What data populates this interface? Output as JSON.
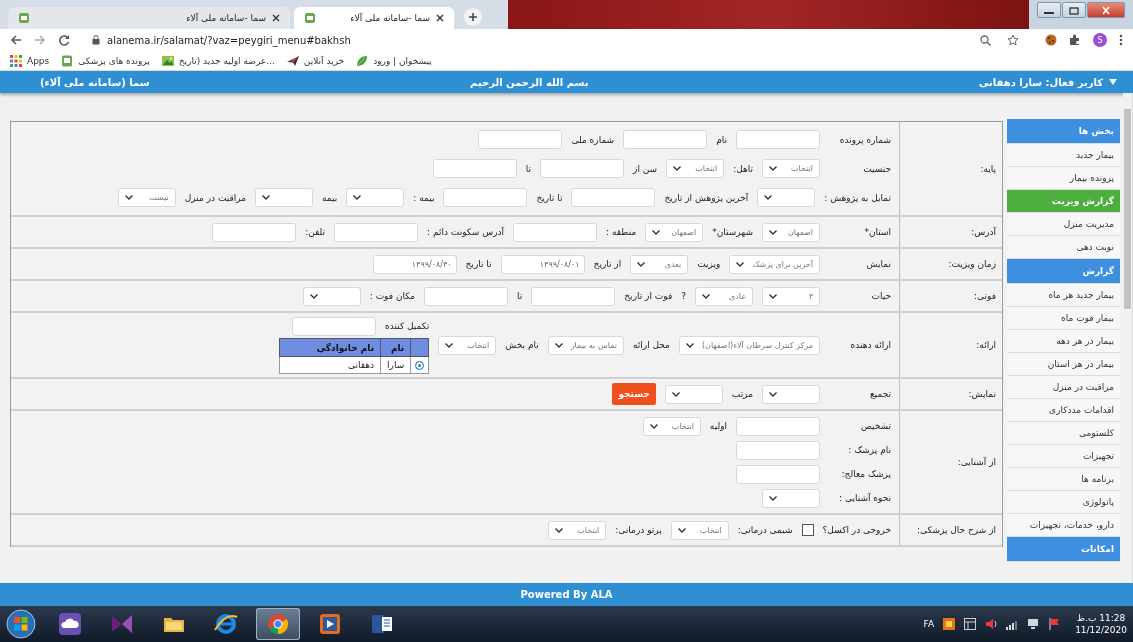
{
  "browser": {
    "tabs": [
      {
        "title": "سما -سامانه ملی آلاء",
        "selected": true
      },
      {
        "title": "سما -سامانه ملی آلاء",
        "selected": false
      }
    ],
    "url": "alanema.ir/salamat/?vaz=peygiri_menu#bakhsh",
    "profile_initial": "S",
    "bookmarks": [
      {
        "kind": "leaf",
        "label": "پیشخوان | ورود"
      },
      {
        "kind": "plane",
        "label": "خرید آنلاین"
      },
      {
        "kind": "image",
        "label": "عرضه اولیه جدید (تاریخ..."
      },
      {
        "kind": "page",
        "label": "پرونده های پزشکی"
      },
      {
        "kind": "apps",
        "label": "Apps"
      }
    ]
  },
  "app": {
    "title": "سما (سامانه ملی آلاء)",
    "greeting": "بسم الله الرحمن الرحیم",
    "user": "کاربر فعال: سارا دهقانی"
  },
  "sidebar": {
    "items": [
      {
        "kind": "header",
        "label": "بخش ها",
        "selected": false
      },
      {
        "kind": "item",
        "label": "بیمار جدید",
        "selected": false
      },
      {
        "kind": "item",
        "label": "پرونده بیمار",
        "selected": false
      },
      {
        "kind": "item",
        "label": "گزارش ویزیت",
        "selected": true
      },
      {
        "kind": "item",
        "label": "مدیریت منزل",
        "selected": false
      },
      {
        "kind": "item",
        "label": "نوبت دهی",
        "selected": false
      },
      {
        "kind": "header",
        "label": "گزارش",
        "selected": false
      },
      {
        "kind": "item",
        "label": "بیمار جدید هر ماه",
        "selected": false
      },
      {
        "kind": "item",
        "label": "بیمار فوت ماه",
        "selected": false
      },
      {
        "kind": "item",
        "label": "بیمار در هر دهه",
        "selected": false
      },
      {
        "kind": "item",
        "label": "بیمار در هر استان",
        "selected": false
      },
      {
        "kind": "item",
        "label": "مراقبت در منزل",
        "selected": false
      },
      {
        "kind": "item",
        "label": "اقدامات مددکاری",
        "selected": false
      },
      {
        "kind": "item",
        "label": "کلستومی",
        "selected": false
      },
      {
        "kind": "item",
        "label": "تجهیزات",
        "selected": false
      },
      {
        "kind": "item",
        "label": "برنامه ها",
        "selected": false
      },
      {
        "kind": "item",
        "label": "پاتولوژی",
        "selected": false
      },
      {
        "kind": "item",
        "label": "دارو، خدمات، تجهیزات",
        "selected": false
      },
      {
        "kind": "header",
        "label": "امکانات",
        "selected": false
      }
    ]
  },
  "form": {
    "rows": [
      {
        "label": "پایه:",
        "lines": [
          [
            {
              "kind": "label",
              "text": "شماره پرونده"
            },
            {
              "kind": "input"
            },
            {
              "kind": "label",
              "text": "نام"
            },
            {
              "kind": "input"
            },
            {
              "kind": "label",
              "text": "شماره ملی"
            },
            {
              "kind": "input"
            }
          ],
          [
            {
              "kind": "label",
              "text": "جنسیت"
            },
            {
              "kind": "select",
              "value": "انتخاب"
            },
            {
              "kind": "label",
              "text": "تاهل:"
            },
            {
              "kind": "select",
              "value": "انتخاب"
            },
            {
              "kind": "label",
              "text": "سن از"
            },
            {
              "kind": "input"
            },
            {
              "kind": "label",
              "text": "تا"
            },
            {
              "kind": "input"
            }
          ],
          [
            {
              "kind": "label",
              "text": "تمایل به پژوهش :"
            },
            {
              "kind": "select"
            },
            {
              "kind": "label",
              "text": "آخرین پژوهش از تاریخ"
            },
            {
              "kind": "input"
            },
            {
              "kind": "label",
              "text": "تا تاریخ"
            },
            {
              "kind": "input"
            },
            {
              "kind": "label",
              "text": "بیمه :"
            },
            {
              "kind": "select"
            },
            {
              "kind": "label",
              "text": "بیمه"
            },
            {
              "kind": "select"
            },
            {
              "kind": "label",
              "text": "مراقبت در منزل"
            },
            {
              "kind": "select",
              "value": "نیست"
            }
          ]
        ]
      },
      {
        "label": "آدرس:",
        "lines": [
          [
            {
              "kind": "label",
              "text": "استان*"
            },
            {
              "kind": "select",
              "value": "اصفهان"
            },
            {
              "kind": "label",
              "text": "شهرستان*"
            },
            {
              "kind": "select",
              "value": "اصفهان"
            },
            {
              "kind": "label",
              "text": "منطقه :"
            },
            {
              "kind": "input"
            },
            {
              "kind": "label",
              "text": "آدرس سکونت دائم :"
            },
            {
              "kind": "input"
            },
            {
              "kind": "label",
              "text": "تلفن:"
            },
            {
              "kind": "input"
            }
          ]
        ]
      },
      {
        "label": "زمان ویزیت:",
        "lines": [
          [
            {
              "kind": "label",
              "text": "نمایش"
            },
            {
              "kind": "select",
              "value": "آخرین برای پزشک"
            },
            {
              "kind": "label",
              "text": "ویزیت"
            },
            {
              "kind": "select",
              "value": "بعدی"
            },
            {
              "kind": "label",
              "text": "از تاریخ"
            },
            {
              "kind": "input",
              "value": "۱۳۹۹/۰۸/۰۱"
            },
            {
              "kind": "label",
              "text": "تا تاریخ"
            },
            {
              "kind": "input",
              "value": "۱۳۹۹/۰۸/۳۰"
            }
          ]
        ]
      },
      {
        "label": "فوتی:",
        "lines": [
          [
            {
              "kind": "label",
              "text": "حیات"
            },
            {
              "kind": "select",
              "value": "۳"
            },
            {
              "kind": "select",
              "value": "عادی"
            },
            {
              "kind": "label",
              "text": "?"
            },
            {
              "kind": "label",
              "text": "فوت از تاریخ"
            },
            {
              "kind": "input"
            },
            {
              "kind": "label",
              "text": "تا"
            },
            {
              "kind": "input"
            },
            {
              "kind": "label",
              "text": "مکان فوت :"
            },
            {
              "kind": "select"
            }
          ]
        ]
      },
      {
        "label": "ارائه:",
        "lines": [
          [
            {
              "kind": "label",
              "text": "ارائه دهنده"
            },
            {
              "kind": "select",
              "value": "مرکز کنترل سرطان آلاء(اصفهان)"
            },
            {
              "kind": "label",
              "text": "محل ارائه"
            },
            {
              "kind": "select",
              "value": "تماس به بیمار"
            },
            {
              "kind": "label",
              "text": "نام بخش"
            },
            {
              "kind": "select",
              "value": "انتخاب"
            },
            {
              "kind": "group",
              "lines": [
                [
                  {
                    "kind": "label",
                    "text": "تکمیل کننده"
                  },
                  {
                    "kind": "input"
                  }
                ],
                [
                  {
                    "kind": "table",
                    "columns": [
                      "نام",
                      "نام خانوادگی"
                    ],
                    "rows": [
                      {
                        "selected": true,
                        "cells": [
                          "سارا",
                          "دهقانی"
                        ]
                      }
                    ]
                  }
                ]
              ]
            }
          ]
        ]
      },
      {
        "label": "نمایش:",
        "lines": [
          [
            {
              "kind": "label",
              "text": "تجمیع"
            },
            {
              "kind": "select"
            },
            {
              "kind": "label",
              "text": "مرتب"
            },
            {
              "kind": "select"
            },
            {
              "kind": "button",
              "text": "جستجو"
            }
          ]
        ]
      },
      {
        "label": "از آشنایی:",
        "lines": [
          [
            {
              "kind": "label",
              "text": "تشخیص"
            },
            {
              "kind": "input"
            },
            {
              "kind": "label",
              "text": "اولیه"
            },
            {
              "kind": "select",
              "value": "انتخاب"
            }
          ],
          [
            {
              "kind": "label",
              "text": "نام پزشک :"
            },
            {
              "kind": "input"
            }
          ],
          [
            {
              "kind": "label",
              "text": "پزشک معالج:"
            },
            {
              "kind": "input"
            }
          ],
          [
            {
              "kind": "label",
              "text": "نحوه آشنایی :"
            },
            {
              "kind": "select"
            }
          ]
        ]
      },
      {
        "label": "از شرح حال پزشکی:",
        "lines": [
          [
            {
              "kind": "label",
              "text": "خروجی در اکسل؟"
            },
            {
              "kind": "checkbox",
              "checked": false
            },
            {
              "kind": "label",
              "text": "شیمی درمانی:"
            },
            {
              "kind": "select",
              "value": "انتخاب"
            },
            {
              "kind": "label",
              "text": "پرتو درمانی:"
            },
            {
              "kind": "select",
              "value": "انتخاب"
            }
          ]
        ]
      }
    ]
  },
  "footer": "Powered By ALA",
  "taskbar": {
    "apps": [
      {
        "kind": "cloud",
        "active": false
      },
      {
        "kind": "bowtie",
        "active": false
      },
      {
        "kind": "folder",
        "active": false
      },
      {
        "kind": "globe",
        "active": false
      },
      {
        "kind": "chrome",
        "active": true
      },
      {
        "kind": "play",
        "active": false
      },
      {
        "kind": "document",
        "active": false
      }
    ],
    "language": "FA",
    "time": "11:28 ب.ظ",
    "date": "11/12/2020"
  }
}
